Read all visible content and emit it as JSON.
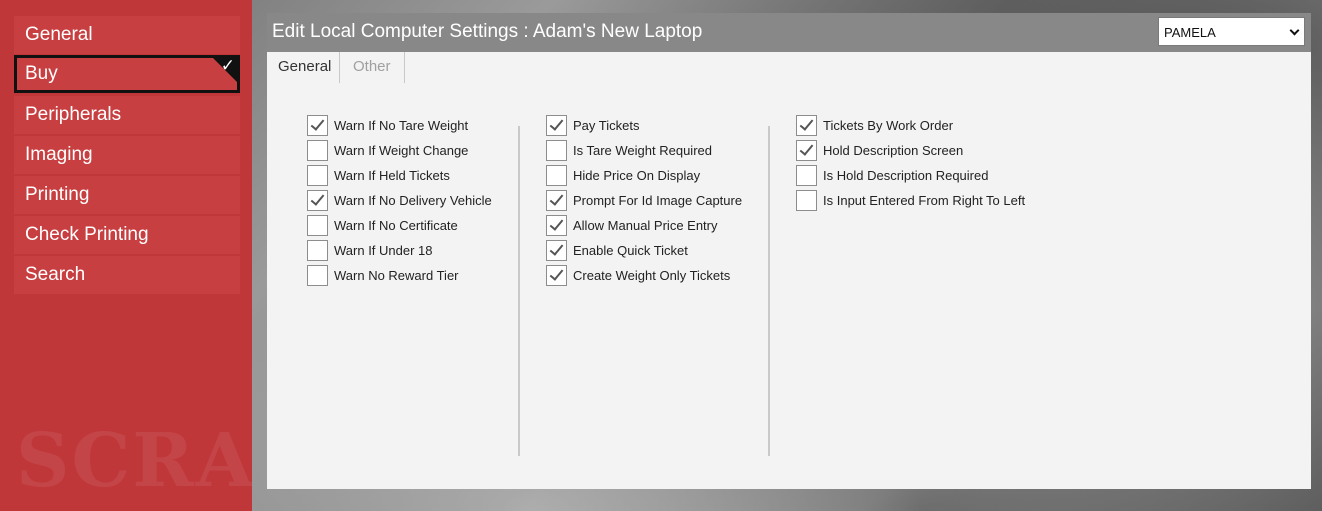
{
  "sidebar": {
    "items": [
      {
        "label": "General",
        "selected": false
      },
      {
        "label": "Buy",
        "selected": true
      },
      {
        "label": "Peripherals",
        "selected": false
      },
      {
        "label": "Imaging",
        "selected": false
      },
      {
        "label": "Printing",
        "selected": false
      },
      {
        "label": "Check Printing",
        "selected": false
      },
      {
        "label": "Search",
        "selected": false
      }
    ],
    "watermark": "SCRAP",
    "color": "#c0373a"
  },
  "panel": {
    "title": "Edit Local Computer Settings :  Adam's New Laptop",
    "user_select": "PAMELA",
    "tabs": [
      {
        "label": "General",
        "active": true
      },
      {
        "label": "Other",
        "active": false
      }
    ]
  },
  "columns": [
    [
      {
        "label": "Warn If No Tare Weight",
        "checked": true
      },
      {
        "label": "Warn If Weight Change",
        "checked": false
      },
      {
        "label": "Warn If Held Tickets",
        "checked": false
      },
      {
        "label": "Warn If No Delivery Vehicle",
        "checked": true
      },
      {
        "label": "Warn If No Certificate",
        "checked": false
      },
      {
        "label": "Warn If Under 18",
        "checked": false
      },
      {
        "label": "Warn No Reward Tier",
        "checked": false
      }
    ],
    [
      {
        "label": "Pay Tickets",
        "checked": true
      },
      {
        "label": "Is Tare Weight Required",
        "checked": false
      },
      {
        "label": "Hide Price On Display",
        "checked": false
      },
      {
        "label": "Prompt For Id Image Capture",
        "checked": true
      },
      {
        "label": "Allow Manual Price Entry",
        "checked": true
      },
      {
        "label": "Enable Quick Ticket",
        "checked": true
      },
      {
        "label": "Create Weight Only Tickets",
        "checked": true
      }
    ],
    [
      {
        "label": "Tickets By Work Order",
        "checked": true
      },
      {
        "label": "Hold Description Screen",
        "checked": true
      },
      {
        "label": "Is Hold Description Required",
        "checked": false
      },
      {
        "label": "Is Input Entered From Right To Left",
        "checked": false
      }
    ]
  ]
}
